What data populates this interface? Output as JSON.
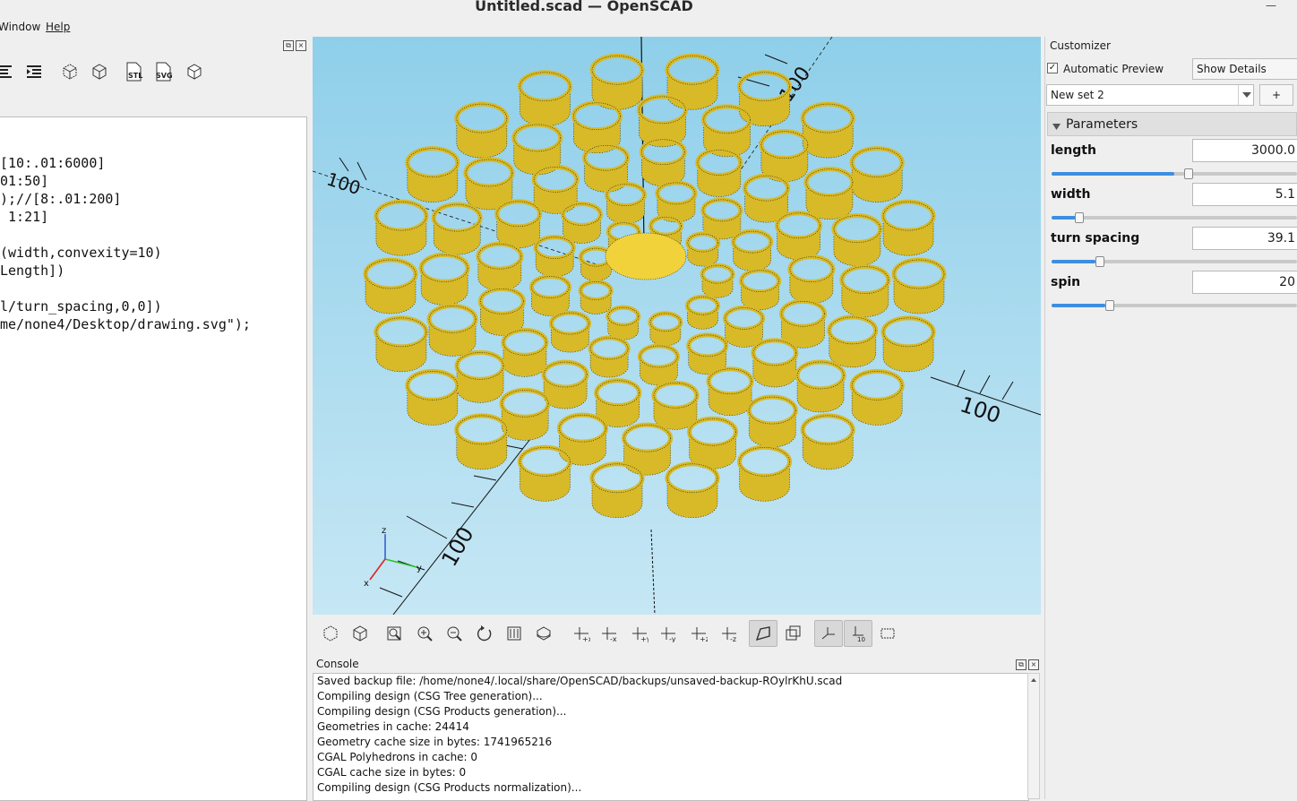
{
  "window": {
    "title": "Untitled.scad — OpenSCAD"
  },
  "menu": {
    "window": "Window",
    "help": "Help"
  },
  "editor": {
    "lines": [
      "[10:.01:6000]",
      "01:50]",
      ");//[8:.01:200]",
      " 1:21]",
      "",
      "(width,convexity=10)",
      "Length])",
      "",
      "l/turn_spacing,0,0])",
      "me/none4/Desktop/drawing.svg\");"
    ]
  },
  "toolbar_labels": {
    "stl": "STL",
    "svg": "SVG"
  },
  "viewport": {
    "axis_label_top": "100",
    "axis_label_left": "100",
    "axis_label_right": "100",
    "axis_label_bottom": "100",
    "gizmo_x": "x",
    "gizmo_y": "y",
    "gizmo_z": "z"
  },
  "console": {
    "title": "Console",
    "lines": [
      "Saved backup file: /home/none4/.local/share/OpenSCAD/backups/unsaved-backup-ROylrKhU.scad",
      "Compiling design (CSG Tree generation)...",
      "Compiling design (CSG Products generation)...",
      "Geometries in cache: 24414",
      "Geometry cache size in bytes: 1741965216",
      "CGAL Polyhedrons in cache: 0",
      "CGAL cache size in bytes: 0",
      "Compiling design (CSG Products normalization)..."
    ]
  },
  "customizer": {
    "title": "Customizer",
    "auto_preview_label": "Automatic Preview",
    "auto_preview_checked": true,
    "details_select": "Show Details",
    "preset_select": "New set 2",
    "add_button": "+",
    "section_title": "Parameters",
    "params": [
      {
        "name": "length",
        "value": "3000.0",
        "slider_fraction": 0.5
      },
      {
        "name": "width",
        "value": "5.1",
        "slider_fraction": 0.1
      },
      {
        "name": "turn spacing",
        "value": "39.1",
        "slider_fraction": 0.18
      },
      {
        "name": "spin",
        "value": "20",
        "slider_fraction": 0.22
      }
    ]
  },
  "colors": {
    "model": "#d8b928",
    "model_edge": "#2a2a00",
    "viewport_top": "#8fcfea",
    "viewport_bottom": "#c6e7f4",
    "slider": "#3d8ee0"
  }
}
